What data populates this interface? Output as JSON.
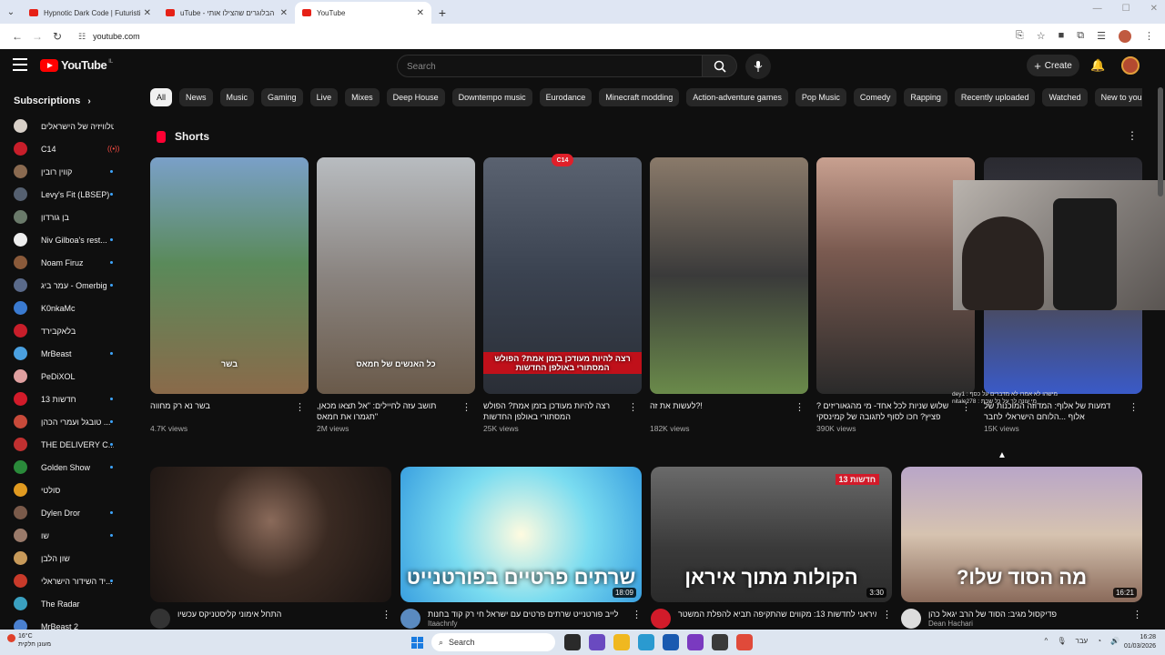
{
  "browser": {
    "tabs": [
      {
        "title": "Hypnotic Dark Code | Futuristic",
        "active": false
      },
      {
        "title": "uTube - הבלוגרים שהצילו אותי",
        "active": false
      },
      {
        "title": "YouTube",
        "active": true
      }
    ],
    "url": "youtube.com"
  },
  "header": {
    "logo_text": "YouTube",
    "region": "IL",
    "search_placeholder": "Search",
    "create_label": "Create"
  },
  "sidebar": {
    "heading": "Subscriptions",
    "items": [
      {
        "name": "טלוויזיה של הישראלים",
        "color": "#d8d0c8",
        "dot": false
      },
      {
        "name": "C14",
        "color": "#c81e2a",
        "live": true
      },
      {
        "name": "קווין רובין",
        "color": "#8a6a50",
        "dot": true
      },
      {
        "name": "Levy's Fit (LBSEP)",
        "color": "#556070",
        "dot": true
      },
      {
        "name": "בן גורדון",
        "color": "#6a7a6a",
        "dot": false
      },
      {
        "name": "Niv Gilboa's rest...",
        "color": "#eeeeee",
        "dot": true
      },
      {
        "name": "Noam Firuz",
        "color": "#8a5a3a",
        "dot": true
      },
      {
        "name": "עמר ביג - Omerbig",
        "color": "#5a6a8a",
        "dot": true
      },
      {
        "name": "K0nkaMc",
        "color": "#3a7ad0",
        "dot": false
      },
      {
        "name": "בלאקבירד",
        "color": "#c81e2a",
        "dot": false
      },
      {
        "name": "MrBeast",
        "color": "#4aa0e0",
        "dot": true
      },
      {
        "name": "PeDiXOL",
        "color": "#e0a0a0",
        "dot": false
      },
      {
        "name": "חדשות 13",
        "color": "#d21b2a",
        "dot": true
      },
      {
        "name": "טובגל ועמרי הכהן ...",
        "color": "#c84a3a",
        "dot": true
      },
      {
        "name": "THE DELIVERY C...",
        "color": "#c03030",
        "dot": true
      },
      {
        "name": "Golden Show",
        "color": "#2a8a3a",
        "dot": true
      },
      {
        "name": "סולטי",
        "color": "#e09a20",
        "dot": false
      },
      {
        "name": "Dylen Dror",
        "color": "#7a5a4a",
        "dot": true
      },
      {
        "name": "שו",
        "color": "#9a7a6a",
        "dot": true
      },
      {
        "name": "שון הלבן",
        "color": "#c89a5a",
        "dot": false
      },
      {
        "name": "יד השידור הישראלי...",
        "color": "#c83a2a",
        "dot": true
      },
      {
        "name": "The Radar",
        "color": "#3aa0c0",
        "dot": false
      },
      {
        "name": "MrBeast 2",
        "color": "#4a80d0",
        "dot": false
      }
    ]
  },
  "chips": [
    "All",
    "News",
    "Music",
    "Gaming",
    "Live",
    "Mixes",
    "Deep House",
    "Downtempo music",
    "Eurodance",
    "Minecraft modding",
    "Action-adventure games",
    "Pop Music",
    "Comedy",
    "Rapping",
    "Recently uploaded",
    "Watched",
    "New to you"
  ],
  "shorts": {
    "heading": "Shorts",
    "items": [
      {
        "title": "בשר נא רק מחווה",
        "views": "4.7K views",
        "caption": "בשר",
        "caption_red": false,
        "bg": "linear-gradient(180deg,#7aa0c8 0%,#5a8a5a 45%,#8a6a4a 100%)",
        "badge": ""
      },
      {
        "title": "תושב עזה לחיילים: \"אל תצאו מכאן, \"תגמרו את חמאס",
        "views": "2M views",
        "caption": "כל האנשים של חמאס",
        "caption_red": false,
        "bg": "linear-gradient(180deg,#b8bcc0 0%,#8a8480 50%,#6a5a4a 100%)",
        "badge": ""
      },
      {
        "title": "רצה להיות מעודכן בזמן אמת? הפולש המסתורי באולפן החדשות",
        "views": "25K views",
        "caption": "רצה להיות מעודכן בזמן אמת? הפולש המסתורי באולפן החדשות",
        "caption_red": true,
        "bg": "linear-gradient(180deg,#5a6270 0%,#3a4250 50%,#2a2e36 100%)",
        "badge": "C14"
      },
      {
        "title": "!?לעשות את זה",
        "views": "182K views",
        "caption": "",
        "caption_red": false,
        "bg": "linear-gradient(180deg,#8a7a6a 0%,#3a3a3a 50%,#6a8a4a 100%)",
        "badge": ""
      },
      {
        "title": "שלוש שניות לכל אחד- מי מהגאוריזים ?פציץ? חכו לסוף לתגובה של קמינסקי",
        "views": "390K views",
        "caption": "",
        "caption_red": false,
        "bg": "linear-gradient(180deg,#c8a090 0%,#7a5a50 40%,#2a2a2a 100%)",
        "badge": ""
      },
      {
        "title": "דמעות של אלוף: המדוזה המוכנות של אלוף ...הלוחם הישראלי לחבר",
        "views": "15K views",
        "caption": "",
        "caption_red": false,
        "bg": "linear-gradient(180deg,#2a2a30 0%,#4a4a5a 60%,#3a5ac8 100%)",
        "badge": ""
      }
    ]
  },
  "chat_lines": [
    "dey1 : מישהו לא אמרו לא מדברים על כסף",
    "nitale278 : מי עונה לך על כל שבת"
  ],
  "videos": [
    {
      "title": "התחל אימוני קליסטניקס עכשיו",
      "channel": "",
      "duration": "",
      "caption": "",
      "bg": "radial-gradient(circle at 50% 40%,#8a6a5a 0%,#3a2a22 40%,#1a1412 100%)",
      "tag": "",
      "avatar": "#333"
    },
    {
      "title": "לייב פורטנייט שרתים פרטים עם ישראל חי רק קוד בחנות",
      "channel": "Itaachnfy",
      "duration": "18:09",
      "caption": "שרתים פרטיים בפורטנייט",
      "bg": "radial-gradient(circle at 50% 50%,#fffbe0 0%,#7adcf0 50%,#3aa0e0 100%)",
      "tag": "",
      "avatar": "#5a8ac0"
    },
    {
      "title": "אזרח איראני לחדשות 13: מקווים שהתקיפה תביא להפלת המשטר",
      "channel": "",
      "duration": "3:30",
      "caption": "הקולות מתוך איראן",
      "bg": "linear-gradient(180deg,#6a6a6a 0%,#3a3a3a 60%,#2a2a2a 100%)",
      "tag": "חדשות 13",
      "avatar": "#d21b2a"
    },
    {
      "title": "פדיקסול מגיב: הסוד של הרב יגאל כהן",
      "channel": "Dean Hachari",
      "duration": "16:21",
      "caption": "?מה הסוד שלו",
      "bg": "linear-gradient(180deg,#b9a6c8 0%,#d6c3b0 50%,#8a6a5a 100%)",
      "tag": "",
      "avatar": "#ddd"
    }
  ],
  "taskbar": {
    "temp": "16°C",
    "weather_text": "מעונן חלקית",
    "search_label": "Search",
    "lang": "עבר",
    "time": "16:28",
    "date": "01/03/2026"
  }
}
